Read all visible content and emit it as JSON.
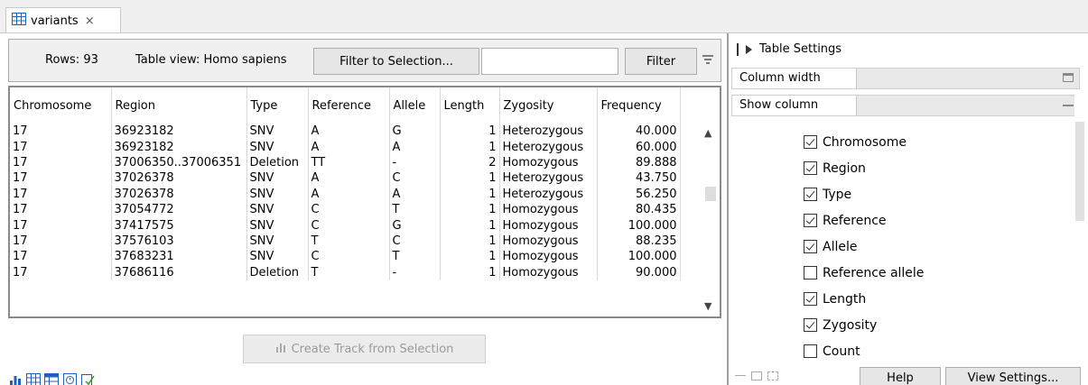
{
  "tab": {
    "label": "variants",
    "close": "×"
  },
  "toolbar": {
    "rows": "Rows: 93",
    "table_view": "Table view: Homo sapiens",
    "filter_to_selection": "Filter to Selection...",
    "filter_input_value": "",
    "filter": "Filter"
  },
  "table": {
    "columns": [
      "Chromosome",
      "Region",
      "Type",
      "Reference",
      "Allele",
      "Length",
      "Zygosity",
      "Frequency"
    ],
    "rows": [
      [
        "17",
        "36923182",
        "SNV",
        "A",
        "G",
        "1",
        "Heterozygous",
        "40.000"
      ],
      [
        "17",
        "36923182",
        "SNV",
        "A",
        "A",
        "1",
        "Heterozygous",
        "60.000"
      ],
      [
        "17",
        "37006350..37006351",
        "Deletion",
        "TT",
        "-",
        "2",
        "Homozygous",
        "89.888"
      ],
      [
        "17",
        "37026378",
        "SNV",
        "A",
        "C",
        "1",
        "Heterozygous",
        "43.750"
      ],
      [
        "17",
        "37026378",
        "SNV",
        "A",
        "A",
        "1",
        "Heterozygous",
        "56.250"
      ],
      [
        "17",
        "37054772",
        "SNV",
        "C",
        "T",
        "1",
        "Homozygous",
        "80.435"
      ],
      [
        "17",
        "37417575",
        "SNV",
        "C",
        "G",
        "1",
        "Homozygous",
        "100.000"
      ],
      [
        "17",
        "37576103",
        "SNV",
        "T",
        "C",
        "1",
        "Homozygous",
        "88.235"
      ],
      [
        "17",
        "37683231",
        "SNV",
        "C",
        "T",
        "1",
        "Homozygous",
        "100.000"
      ],
      [
        "17",
        "37686116",
        "Deletion",
        "T",
        "-",
        "1",
        "Homozygous",
        "90.000"
      ]
    ]
  },
  "create_track": "Create Track from Selection",
  "settings": {
    "title": "Table Settings",
    "column_width": "Column width",
    "show_column": "Show column",
    "columns": [
      {
        "label": "Chromosome",
        "checked": true
      },
      {
        "label": "Region",
        "checked": true
      },
      {
        "label": "Type",
        "checked": true
      },
      {
        "label": "Reference",
        "checked": true
      },
      {
        "label": "Allele",
        "checked": true
      },
      {
        "label": "Reference allele",
        "checked": false
      },
      {
        "label": "Length",
        "checked": true
      },
      {
        "label": "Zygosity",
        "checked": true
      },
      {
        "label": "Count",
        "checked": false
      }
    ],
    "help": "Help",
    "view_settings": "View Settings..."
  },
  "colors": {
    "accent": "#1f5fbf",
    "border": "#adadad"
  },
  "icons": [
    "table-icon",
    "close-icon",
    "menu-icon",
    "bar-chart-icon",
    "table-view-icon",
    "table-edit-icon",
    "history-icon",
    "annotation-icon",
    "collapse-icon",
    "folder-icon",
    "minimize-icon"
  ]
}
